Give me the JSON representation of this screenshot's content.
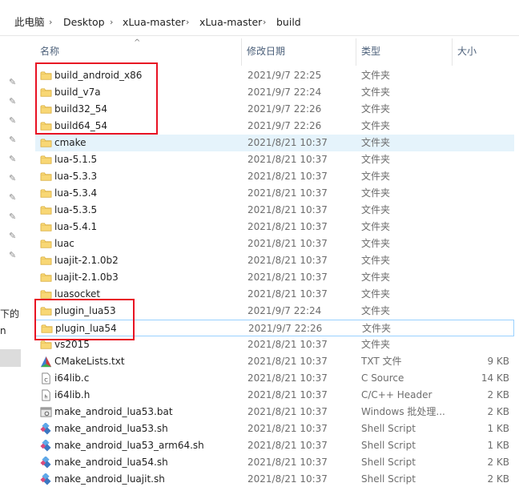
{
  "breadcrumb": [
    "此电脑",
    "Desktop",
    "xLua-master",
    "xLua-master",
    "build"
  ],
  "columns": {
    "name": "名称",
    "date": "修改日期",
    "type": "类型",
    "size": "大小"
  },
  "nav": {
    "text1": "下的",
    "text2": "n"
  },
  "files": [
    {
      "name": "build_android_x86",
      "date": "2021/9/7 22:25",
      "type": "文件夹",
      "size": "",
      "icon": "folder-icon"
    },
    {
      "name": "build_v7a",
      "date": "2021/9/7 22:24",
      "type": "文件夹",
      "size": "",
      "icon": "folder-icon"
    },
    {
      "name": "build32_54",
      "date": "2021/9/7 22:26",
      "type": "文件夹",
      "size": "",
      "icon": "folder-icon"
    },
    {
      "name": "build64_54",
      "date": "2021/9/7 22:26",
      "type": "文件夹",
      "size": "",
      "icon": "folder-icon"
    },
    {
      "name": "cmake",
      "date": "2021/8/21 10:37",
      "type": "文件夹",
      "size": "",
      "icon": "folder-icon"
    },
    {
      "name": "lua-5.1.5",
      "date": "2021/8/21 10:37",
      "type": "文件夹",
      "size": "",
      "icon": "folder-icon"
    },
    {
      "name": "lua-5.3.3",
      "date": "2021/8/21 10:37",
      "type": "文件夹",
      "size": "",
      "icon": "folder-icon"
    },
    {
      "name": "lua-5.3.4",
      "date": "2021/8/21 10:37",
      "type": "文件夹",
      "size": "",
      "icon": "folder-icon"
    },
    {
      "name": "lua-5.3.5",
      "date": "2021/8/21 10:37",
      "type": "文件夹",
      "size": "",
      "icon": "folder-icon"
    },
    {
      "name": "lua-5.4.1",
      "date": "2021/8/21 10:37",
      "type": "文件夹",
      "size": "",
      "icon": "folder-icon"
    },
    {
      "name": "luac",
      "date": "2021/8/21 10:37",
      "type": "文件夹",
      "size": "",
      "icon": "folder-icon"
    },
    {
      "name": "luajit-2.1.0b2",
      "date": "2021/8/21 10:37",
      "type": "文件夹",
      "size": "",
      "icon": "folder-icon"
    },
    {
      "name": "luajit-2.1.0b3",
      "date": "2021/8/21 10:37",
      "type": "文件夹",
      "size": "",
      "icon": "folder-icon"
    },
    {
      "name": "luasocket",
      "date": "2021/8/21 10:37",
      "type": "文件夹",
      "size": "",
      "icon": "folder-icon"
    },
    {
      "name": "plugin_lua53",
      "date": "2021/9/7 22:24",
      "type": "文件夹",
      "size": "",
      "icon": "folder-icon"
    },
    {
      "name": "plugin_lua54",
      "date": "2021/9/7 22:26",
      "type": "文件夹",
      "size": "",
      "icon": "folder-icon"
    },
    {
      "name": "vs2015",
      "date": "2021/8/21 10:37",
      "type": "文件夹",
      "size": "",
      "icon": "folder-icon"
    },
    {
      "name": "CMakeLists.txt",
      "date": "2021/8/21 10:37",
      "type": "TXT 文件",
      "size": "9 KB",
      "icon": "cmake-icon"
    },
    {
      "name": "i64lib.c",
      "date": "2021/8/21 10:37",
      "type": "C Source",
      "size": "14 KB",
      "icon": "c-file-icon"
    },
    {
      "name": "i64lib.h",
      "date": "2021/8/21 10:37",
      "type": "C/C++ Header",
      "size": "2 KB",
      "icon": "h-file-icon"
    },
    {
      "name": "make_android_lua53.bat",
      "date": "2021/8/21 10:37",
      "type": "Windows 批处理...",
      "size": "2 KB",
      "icon": "bat-file-icon"
    },
    {
      "name": "make_android_lua53.sh",
      "date": "2021/8/21 10:37",
      "type": "Shell Script",
      "size": "1 KB",
      "icon": "shell-script-icon"
    },
    {
      "name": "make_android_lua53_arm64.sh",
      "date": "2021/8/21 10:37",
      "type": "Shell Script",
      "size": "1 KB",
      "icon": "shell-script-icon"
    },
    {
      "name": "make_android_lua54.sh",
      "date": "2021/8/21 10:37",
      "type": "Shell Script",
      "size": "2 KB",
      "icon": "shell-script-icon"
    },
    {
      "name": "make_android_luajit.sh",
      "date": "2021/8/21 10:37",
      "type": "Shell Script",
      "size": "2 KB",
      "icon": "shell-script-icon"
    }
  ],
  "colors": {
    "folder": "#f8d775",
    "annotation": "#e81123",
    "hover": "#e5f3fb"
  }
}
